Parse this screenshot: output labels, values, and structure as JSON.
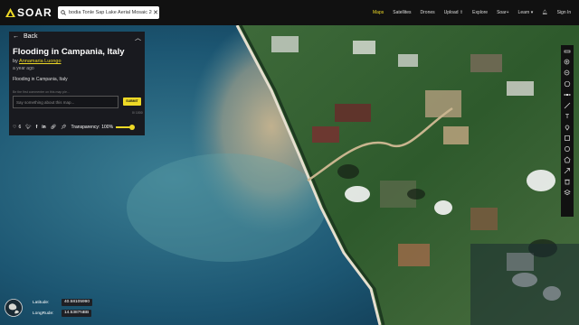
{
  "app": {
    "logo_text": "SOAR"
  },
  "search": {
    "value": "bodia Tonle Sap Lake Aerial Mosaic 2005"
  },
  "nav": {
    "items": [
      "Maps",
      "Satellites",
      "Drones",
      "Upload",
      "Explore",
      "Soar+",
      "Learn",
      "Sign In"
    ],
    "active": "Maps"
  },
  "panel": {
    "back_label": "Back",
    "title": "Flooding in Campania, Italy",
    "by_prefix": "by",
    "author": "Annamaria Luongo",
    "time_ago": "a year ago",
    "description": "Flooding in Campania, Italy",
    "comment_notice": "Be the first commenter on this map ple...",
    "comment_placeholder": "Say something about this map...",
    "submit_label": "SUBMIT",
    "char_count": "0/ 1000",
    "like_count": "6",
    "transparency_label": "Transparency:",
    "transparency_value": "100%"
  },
  "coords": {
    "lat_label": "Latitude:",
    "lat_value": "40.58105990",
    "lng_label": "LongRude:",
    "lng_value": "14.5387NBB"
  },
  "toolbar": {
    "icons": [
      "ruler-icon",
      "zoom-in-icon",
      "zoom-out-icon",
      "reset-icon",
      "satellite-icon",
      "drawing-icon",
      "text-icon",
      "marker-icon",
      "rectangle-icon",
      "circle-icon",
      "polygon-icon",
      "arrow-icon",
      "delete-icon",
      "layer-icon"
    ]
  },
  "colors": {
    "accent": "#eed926",
    "panel_bg": "#191a1f",
    "topbar_bg": "#111111"
  }
}
